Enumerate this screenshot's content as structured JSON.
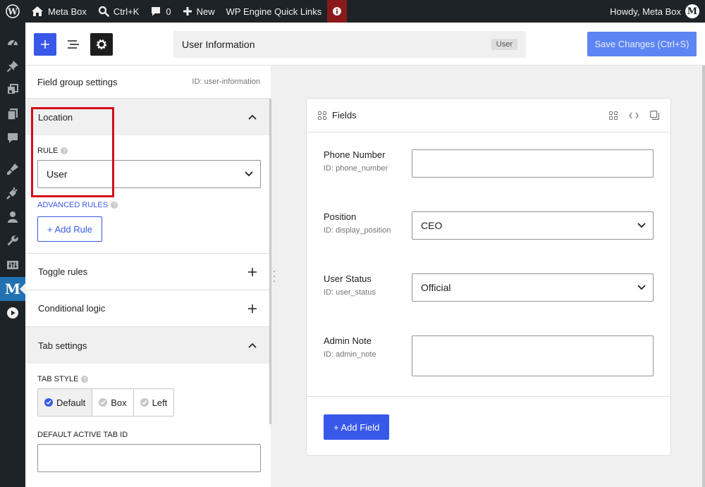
{
  "admin_bar": {
    "site_name": "Meta Box",
    "search_shortcut": "Ctrl+K",
    "comments_count": "0",
    "new_label": "New",
    "quick_links": "WP Engine Quick Links",
    "greeting": "Howdy, Meta Box",
    "avatar_letter": "M"
  },
  "toolbar": {
    "title": "User Information",
    "type_badge": "User",
    "save_label": "Save Changes (Ctrl+S)"
  },
  "sidebar": {
    "header_title": "Field group settings",
    "header_id": "ID: user-information",
    "location": {
      "title": "Location",
      "rule_label": "RULE",
      "rule_value": "User",
      "advanced_label": "ADVANCED RULES",
      "add_rule_label": "+ Add Rule"
    },
    "toggle_rules": "Toggle rules",
    "conditional_logic": "Conditional logic",
    "tab_settings": {
      "title": "Tab settings",
      "style_label": "TAB STYLE",
      "options": [
        "Default",
        "Box",
        "Left"
      ],
      "selected": "Default",
      "active_tab_label": "DEFAULT ACTIVE TAB ID"
    }
  },
  "fields_panel": {
    "title": "Fields",
    "fields": [
      {
        "label": "Phone Number",
        "id": "ID: phone_number",
        "value": ""
      },
      {
        "label": "Position",
        "id": "ID: display_position",
        "value": "CEO"
      },
      {
        "label": "User Status",
        "id": "ID: user_status",
        "value": "Official"
      },
      {
        "label": "Admin Note",
        "id": "ID: admin_note",
        "value": ""
      }
    ],
    "add_field_label": "+ Add Field"
  },
  "colors": {
    "accent": "#3858e9",
    "admin_bar": "#1d2327",
    "highlight": "#d20d1a"
  }
}
